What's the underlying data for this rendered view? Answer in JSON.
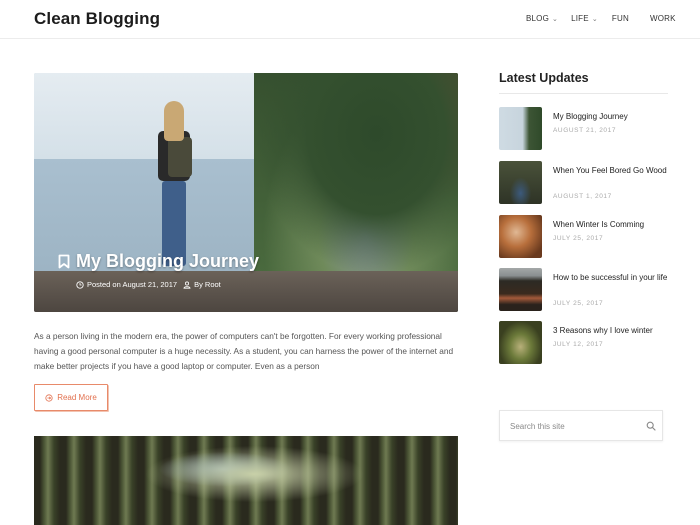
{
  "header": {
    "site_title": "Clean Blogging",
    "nav": [
      {
        "label": "BLOG",
        "has_dropdown": true
      },
      {
        "label": "LIFE",
        "has_dropdown": true
      },
      {
        "label": "FUN",
        "has_dropdown": false
      },
      {
        "label": "WORK",
        "has_dropdown": false
      }
    ],
    "dropdown_icon": "chevron-down-icon"
  },
  "featured_post": {
    "title": "My Blogging Journey",
    "title_icon": "bookmark-icon",
    "posted_on": "Posted on August 21, 2017",
    "posted_icon": "clock-icon",
    "author": "By Root",
    "author_icon": "user-icon",
    "excerpt": "As a person living in the modern era, the power of computers can't be forgotten. For every working professional having a good personal computer is a huge necessity. As a student, you can harness the power of the internet and make better projects if you have a good laptop or computer. Even as a person",
    "read_more_label": "Read More",
    "read_more_icon": "arrow-circle-icon",
    "accent_color": "#e2704e"
  },
  "sidebar": {
    "title": "Latest Updates",
    "posts": [
      {
        "title": "My Blogging Journey",
        "date": "AUGUST 21, 2017"
      },
      {
        "title": "When You Feel Bored Go Wood",
        "date": "AUGUST 1, 2017"
      },
      {
        "title": "When Winter Is Comming",
        "date": "JULY 25, 2017"
      },
      {
        "title": "How to be successful in your life",
        "date": "JULY 25, 2017"
      },
      {
        "title": "3 Reasons why I love winter",
        "date": "JULY 12, 2017"
      }
    ],
    "search": {
      "placeholder": "Search this site",
      "value": "",
      "icon": "search-icon"
    }
  }
}
